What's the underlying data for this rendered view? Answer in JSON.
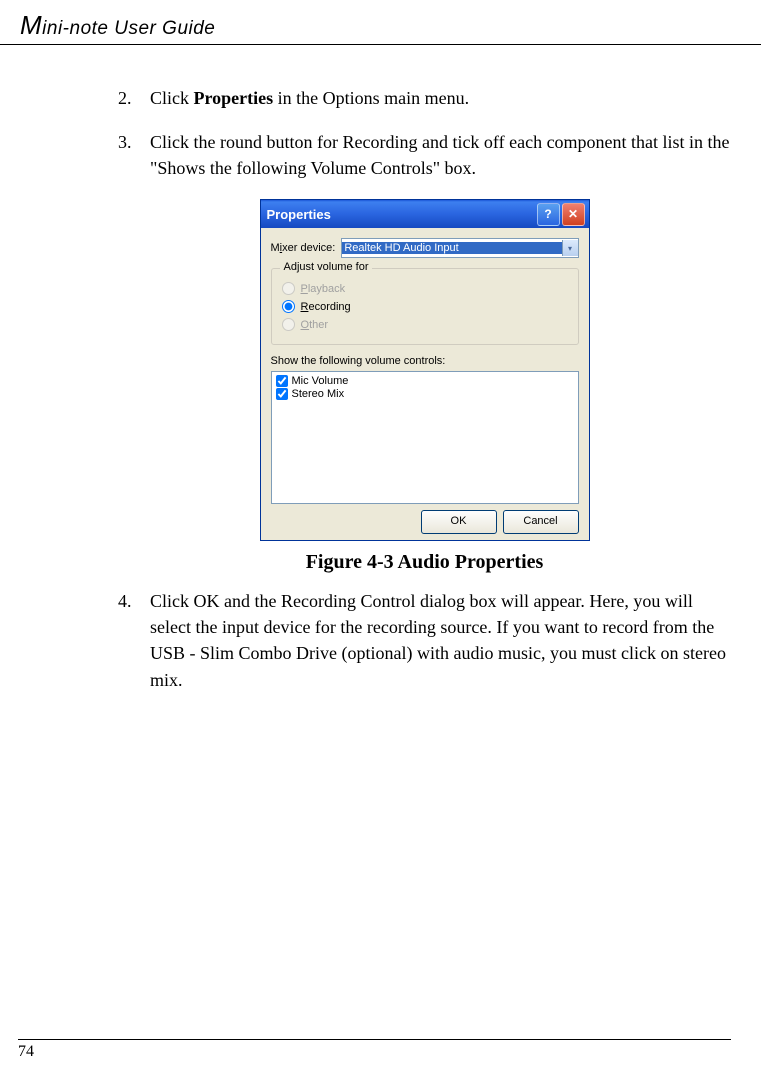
{
  "header": {
    "title": "Mini-note User Guide"
  },
  "steps": {
    "s2": {
      "num": "2.",
      "prefix": "Click ",
      "bold": "Properties",
      "suffix": " in the Options main menu."
    },
    "s3": {
      "num": "3.",
      "text": "Click the round button for Recording and tick off each component that list in the \"Shows the following Volume Controls\" box."
    },
    "s4": {
      "num": "4.",
      "text": "Click OK and the Recording Control dialog box will appear. Here, you will select the input device for the recording source. If you want to record from the USB - Slim Combo Drive (optional) with audio music, you must click on stereo mix."
    }
  },
  "dialog": {
    "title": "Properties",
    "mixer_label": "Mixer device:",
    "mixer_value": "Realtek HD Audio Input",
    "group_title": "Adjust volume for",
    "radio_playback": "Playback",
    "radio_recording": "Recording",
    "radio_other": "Other",
    "show_label": "Show the following volume controls:",
    "chk_mic": "Mic Volume",
    "chk_stereo": "Stereo Mix",
    "btn_ok": "OK",
    "btn_cancel": "Cancel"
  },
  "figure_caption": "Figure 4-3  Audio Properties",
  "page_number": "74"
}
